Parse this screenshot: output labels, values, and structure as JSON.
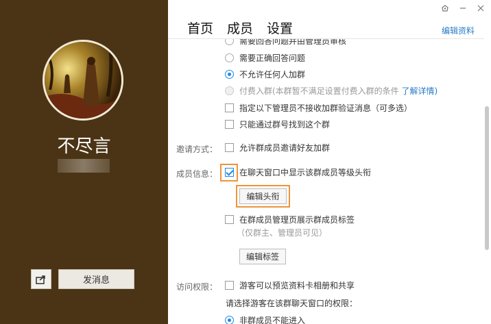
{
  "left": {
    "group_name": "不尽言",
    "send_message": "发消息",
    "share_icon": "share-icon"
  },
  "window": {
    "controls": [
      "skin-icon",
      "minimize-icon",
      "close-icon"
    ]
  },
  "tabs": [
    {
      "label": "首页"
    },
    {
      "label": "成员"
    },
    {
      "label": "设置"
    }
  ],
  "edit_profile": "编辑资料",
  "join": {
    "opt_partial": "需要回答问题并由管理员审核",
    "opt_answer": "需要正确回答问题",
    "opt_deny": "不允许任何人加群",
    "opt_paid": "付费入群(本群暂不满足设置付费入群的条件",
    "opt_paid_link": "了解详情)",
    "opt_admin": "指定以下管理员不接收加群验证消息（可多选）",
    "opt_search": "只能通过群号找到这个群"
  },
  "invite": {
    "label": "邀请方式：",
    "opt": "允许群成员邀请好友加群"
  },
  "member_info": {
    "label": "成员信息：",
    "opt_title": "在聊天窗口中显示该群成员等级头衔",
    "edit_title_btn": "编辑头衔",
    "opt_tags": "在群成员管理页展示群成员标签",
    "tags_note": "（仅群主、管理员可见）",
    "edit_tags_btn": "编辑标签"
  },
  "access": {
    "label": "访问权限：",
    "opt_visitor": "游客可以预览资料卡相册和共享",
    "select_prompt": "请选择游客在该群聊天窗口的权限：",
    "opt_nonmember": "非群成员不能进入"
  },
  "colors": {
    "left_bg": "#4b3415",
    "accent": "#1e88e5",
    "highlight": "#f0923a",
    "link": "#2a7cc7"
  }
}
